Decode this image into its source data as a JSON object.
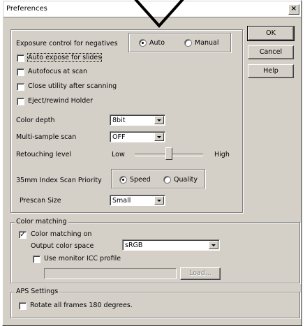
{
  "window": {
    "title": "Preferences",
    "close_label": "×"
  },
  "buttons": {
    "ok": "OK",
    "cancel": "Cancel",
    "help": "Help",
    "load": "Load..."
  },
  "exposure": {
    "label": "Exposure control for negatives",
    "options": [
      "Auto",
      "Manual"
    ],
    "selected": "Auto"
  },
  "checkboxes": {
    "auto_expose": {
      "label": "Auto expose for slides",
      "checked": false
    },
    "autofocus": {
      "label": "Autofocus at scan",
      "checked": false
    },
    "close_utility": {
      "label": "Close utility after scanning",
      "checked": false
    },
    "eject": {
      "label": "Eject/rewind Holder",
      "checked": false
    }
  },
  "color_depth": {
    "label": "Color depth",
    "value": "8bit"
  },
  "multi_sample": {
    "label": "Multi-sample scan",
    "value": "OFF"
  },
  "retouching": {
    "label": "Retouching level",
    "low": "Low",
    "high": "High",
    "level": 0.5
  },
  "index_scan": {
    "label": "35mm Index Scan Priority",
    "options": [
      "Speed",
      "Quality"
    ],
    "selected": "Speed"
  },
  "prescan": {
    "label": "Prescan Size",
    "value": "Small"
  },
  "color_matching": {
    "title": "Color matching",
    "matching_on": {
      "label": "Color matching on",
      "checked": true
    },
    "output_label": "Output color space",
    "output_value": "sRGB",
    "monitor_icc": {
      "label": "Use monitor ICC profile",
      "checked": false
    },
    "profile_path": ""
  },
  "aps": {
    "title": "APS Settings",
    "rotate": {
      "label": "Rotate all frames 180 degrees.",
      "checked": false
    }
  },
  "colors": {
    "face": "#d4d0c8",
    "shadow": "#808080",
    "highlight": "#ffffff"
  }
}
